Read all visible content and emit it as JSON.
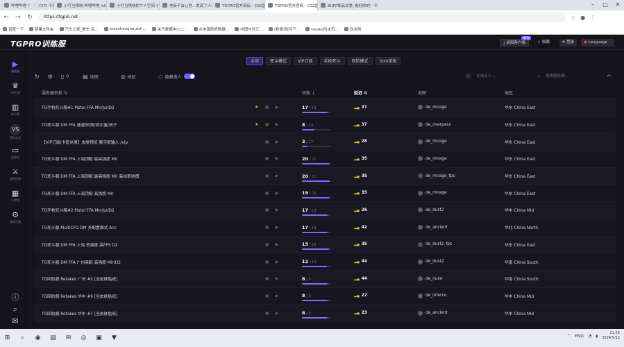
{
  "browser": {
    "tabs": [
      {
        "label": "哔哩哔哩 (゜-゜)つロ 干杯~-bilibi",
        "active": false
      },
      {
        "label": "小叮当喷绕-哔哩哔哩_bilibili",
        "active": false
      },
      {
        "label": "小叮当喷绕的个人空间-小叮当绕",
        "active": false
      },
      {
        "label": "老板不会让你...发现了人才Kkx",
        "active": false
      },
      {
        "label": "TGPRO官方商店 - CS2国服社区",
        "active": false
      },
      {
        "label": "TGPRO官方官网 - CS2国服社区",
        "active": true
      },
      {
        "label": "BUFF饰品交易_看好你的收视率",
        "active": false
      }
    ],
    "new_tab": "+",
    "window_controls": [
      "–",
      "□",
      "✕"
    ],
    "url": "https://tgpro.net",
    "bookmarks": [
      "百度一下",
      "新建文件夹",
      "汽车之家_看车 买...",
      "etaxshenghautsh...",
      "关于数据中心二...",
      "从中国政府数据...",
      "中国与外汇...",
      "(新版)软件下...",
      "nexiko的主页...",
      "饮冰网"
    ]
  },
  "app": {
    "logo": "TGPRO训练服",
    "desktop_btn": "桌面客户端",
    "desktop_new": "NEW",
    "fav_btn": "收藏",
    "login_btn": "登录",
    "lang_btn": "Language"
  },
  "sidebar": [
    {
      "icon": "play-icon",
      "glyph": "▶",
      "label": "服务器",
      "state": "active"
    },
    {
      "icon": "crown-icon",
      "glyph": "♛",
      "label": "VIP订阅",
      "state": ""
    },
    {
      "icon": "chart-icon",
      "glyph": "▥",
      "label": "排行榜",
      "state": ""
    },
    {
      "icon": "vs-icon",
      "glyph": "VS",
      "label": "团队对战",
      "state": "sel"
    },
    {
      "icon": "video-icon",
      "glyph": "▭",
      "label": "回放站",
      "state": ""
    },
    {
      "icon": "knife-icon",
      "glyph": "⚔",
      "label": "皮肤修改",
      "state": ""
    },
    {
      "icon": "grid-icon",
      "glyph": "▦",
      "label": "小游戏",
      "state": ""
    },
    {
      "icon": "settings-icon",
      "glyph": "⚙",
      "label": "服务设置",
      "state": ""
    }
  ],
  "sidebar_bottom": [
    {
      "icon": "info-icon",
      "glyph": "ⓘ"
    },
    {
      "icon": "search-icon",
      "glyph": "⌕"
    },
    {
      "icon": "chat-icon",
      "glyph": "✉"
    }
  ],
  "filters": [
    "全部",
    "死斗模式",
    "VIP订阅",
    "手枪死斗",
    "回防模式",
    "Solo单挑"
  ],
  "active_filter": "全部",
  "toolbar": {
    "count": "0",
    "map_label": "地图",
    "region_label": "地区",
    "hide_label": "隐藏满人",
    "player_search_placeholder": "在线名人...",
    "server_search_placeholder": "搜索服务器..."
  },
  "columns": {
    "name": "服务器名称",
    "players": "玩家",
    "ping": "延迟",
    "map": "地图",
    "region": "地区"
  },
  "rows": [
    {
      "name": "TG手枪死斗服#1 Pistol FFA Mir/Jul/D2",
      "star": true,
      "players": "17",
      "max": "/ 19",
      "fill": 0.89,
      "ping": "37",
      "map": "de_mirage",
      "region": "华东 China East"
    },
    {
      "name": "TG死斗服 DM FFA 速递/阿努/洒尔篮/核子",
      "star": true,
      "players": "8",
      "max": "/ 19",
      "fill": 0.42,
      "ping": "37",
      "map": "de_overpass",
      "region": "华东 China East"
    },
    {
      "name": "【VIP订阅/卡密兑换】皮肤预览 聊天框输入 /vip",
      "star": false,
      "players": "3",
      "max": "/ 17",
      "fill": 0.18,
      "ping": "28",
      "map": "de_mirage",
      "region": "华东 China East"
    },
    {
      "name": "TG死斗服 DM FFA 上海顶配 最高强度 Mir",
      "star": false,
      "players": "20",
      "max": "/ 21",
      "fill": 0.95,
      "ping": "35",
      "map": "de_mirage",
      "region": "华东 China East"
    },
    {
      "name": "TG死斗服 DM FFA 上海顶配 最高强度 Mir 高帧率地图",
      "star": false,
      "players": "20",
      "max": "/ 21",
      "fill": 0.95,
      "ping": "35",
      "map": "de_mirage_fps",
      "region": "华东 China East"
    },
    {
      "name": "TG死斗服 DM FFA 上海顶配 高强度 Mir",
      "star": false,
      "players": "19",
      "max": "/ 20",
      "fill": 0.95,
      "ping": "35",
      "map": "de_mirage",
      "region": "华东 China East"
    },
    {
      "name": "TG手枪死斗服#2 Pistol FFA Mir/Jul/D2",
      "star": false,
      "players": "17",
      "max": "/ 19",
      "fill": 0.89,
      "ping": "26",
      "map": "de_dust2",
      "region": "华中 China Mid"
    },
    {
      "name": "TG死斗服 MultiCFG DM 多配置模式 Anc",
      "star": false,
      "players": "17",
      "max": "/ 19",
      "fill": 0.89,
      "ping": "42",
      "map": "de_ancient",
      "region": "华北 China North"
    },
    {
      "name": "TG死斗服 DM FFA 上海 低强度 高FPS D2",
      "star": false,
      "players": "15",
      "max": "/ 16",
      "fill": 0.94,
      "ping": "35",
      "map": "de_dust2_fps",
      "region": "华东 China East"
    },
    {
      "name": "TG死斗服 DM FFA 广州高配 高强度 Mir/D2",
      "star": false,
      "players": "12",
      "max": "/ 14",
      "fill": 0.86,
      "ping": "44",
      "map": "de_dust2",
      "region": "华南 China South"
    },
    {
      "name": "TG回防服 Retakes 广州 #2 [全皮肤贴纸]",
      "star": false,
      "players": "8",
      "max": "/ 9",
      "fill": 0.89,
      "ping": "44",
      "map": "de_nuke",
      "region": "华南 China South"
    },
    {
      "name": "TG回防服 Retakes 华中 #9 [全皮肤贴纸]",
      "star": false,
      "players": "8",
      "max": "/ 9",
      "fill": 0.89,
      "ping": "22",
      "map": "de_inferno",
      "region": "华中 China Mid"
    },
    {
      "name": "TG回防服 Retakes 华中 #7 [全皮肤贴纸]",
      "star": false,
      "players": "8",
      "max": "/ 9",
      "fill": 0.89,
      "ping": "23",
      "map": "de_ancient",
      "region": "华中 China Mid"
    }
  ],
  "taskbar": {
    "icons": [
      "windows-icon",
      "search-icon",
      "browser-icon",
      "explorer-icon",
      "mail-icon",
      "steam-icon",
      "game-icon",
      "app-icon"
    ],
    "lang": "ENG",
    "time": "21:56",
    "date": "2024/5/12"
  }
}
